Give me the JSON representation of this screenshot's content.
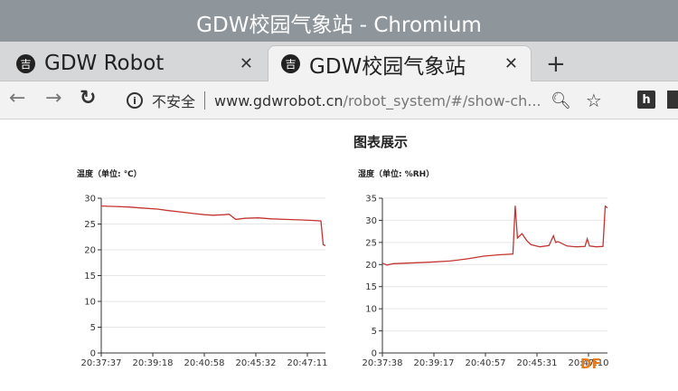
{
  "window": {
    "title": "GDW校园气象站 - Chromium"
  },
  "tabs": [
    {
      "label": "GDW Robot",
      "icon": "吉"
    },
    {
      "label": "GDW校园气象站",
      "icon": "吉"
    }
  ],
  "toolbar": {
    "security_label": "不安全",
    "url_host": "www.gdwrobot.cn",
    "url_path": "/robot_system/#/show-ch..."
  },
  "page": {
    "title": "图表展示"
  },
  "watermark": "DF",
  "chart_data": [
    {
      "type": "line",
      "title": "温度（单位: ℃）",
      "xlabel": "",
      "ylabel": "",
      "ylim": [
        0,
        30
      ],
      "yticks": [
        0,
        5,
        10,
        15,
        20,
        25,
        30
      ],
      "xtick_labels": [
        "20:37:37",
        "20:39:18",
        "20:40:58",
        "20:45:32",
        "20:47:11"
      ],
      "grid": true,
      "color": "#c23531",
      "series": [
        {
          "x": [
            0,
            0.06,
            0.12,
            0.18,
            0.25,
            0.3,
            0.36,
            0.42,
            0.46,
            0.5,
            0.55,
            0.57,
            0.6,
            0.6,
            0.64,
            0.7,
            0.76,
            0.82,
            0.88,
            0.94,
            0.98,
            0.99,
            1.0
          ],
          "values": [
            28.5,
            28.4,
            28.3,
            28.1,
            27.9,
            27.6,
            27.3,
            27.0,
            26.8,
            26.7,
            26.8,
            26.9,
            25.9,
            25.9,
            26.1,
            26.2,
            26.0,
            25.9,
            25.8,
            25.7,
            25.6,
            21.0,
            20.8
          ]
        }
      ]
    },
    {
      "type": "line",
      "title": "湿度（单位: %RH）",
      "xlabel": "",
      "ylabel": "",
      "ylim": [
        0,
        35
      ],
      "yticks": [
        0,
        5,
        10,
        15,
        20,
        25,
        30,
        35
      ],
      "xtick_labels": [
        "20:37:38",
        "20:39:17",
        "20:40:57",
        "20:45:31",
        "20:47:10"
      ],
      "grid": true,
      "color": "#c23531",
      "series": [
        {
          "x": [
            0,
            0.02,
            0.05,
            0.1,
            0.2,
            0.3,
            0.38,
            0.45,
            0.52,
            0.58,
            0.59,
            0.6,
            0.62,
            0.64,
            0.66,
            0.7,
            0.74,
            0.76,
            0.77,
            0.78,
            0.82,
            0.86,
            0.9,
            0.91,
            0.92,
            0.95,
            0.98,
            0.99,
            1.0
          ],
          "values": [
            20.3,
            19.9,
            20.2,
            20.3,
            20.5,
            20.8,
            21.3,
            21.9,
            22.2,
            22.4,
            33.3,
            26.0,
            27.0,
            25.5,
            24.5,
            24.0,
            24.3,
            26.5,
            25.0,
            25.2,
            24.2,
            24.0,
            24.1,
            25.8,
            24.2,
            24.0,
            24.1,
            33.2,
            32.8
          ]
        }
      ]
    }
  ]
}
